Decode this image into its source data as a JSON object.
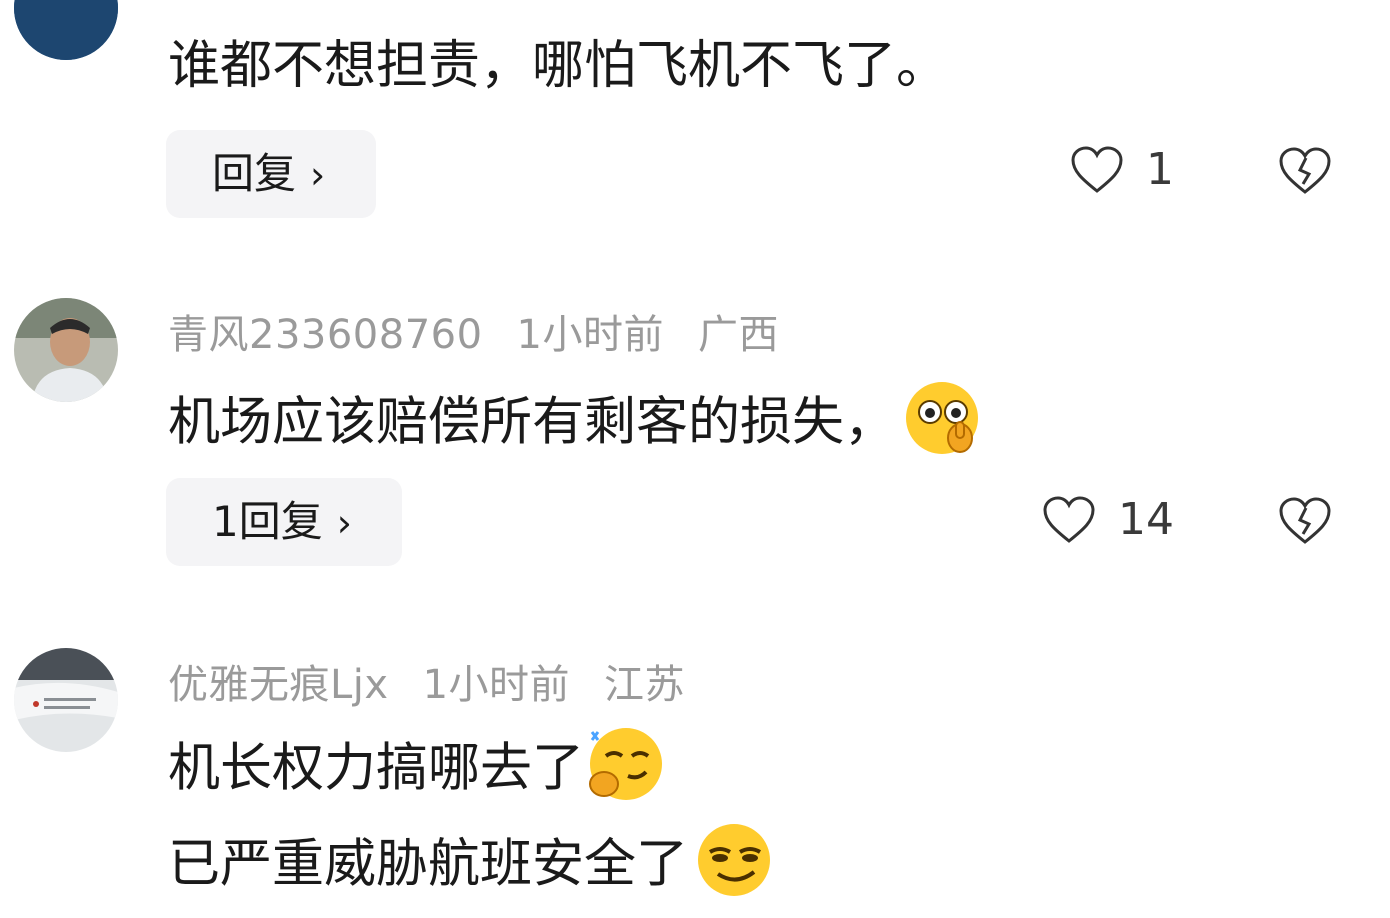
{
  "comments": [
    {
      "author": "",
      "time": "",
      "location": "",
      "text": "谁都不想担责，哪怕飞机不飞了。",
      "reply_label": "回复",
      "reply_chevron": "›",
      "likes": "1",
      "avatar_color": "#2c5f8f",
      "icons": [
        "heart-outline-icon",
        "broken-heart-icon"
      ]
    },
    {
      "author": "青风233608760",
      "time": "1小时前",
      "location": "广西",
      "text": "机场应该赔偿所有剩客的损失，",
      "emoji": "thinking-face-emoji",
      "reply_label": "1回复",
      "reply_chevron": "›",
      "likes": "14",
      "avatar_color": "#8a8f84",
      "icons": [
        "heart-outline-icon",
        "broken-heart-icon"
      ]
    },
    {
      "author": "优雅无痕Ljx",
      "time": "1小时前",
      "location": "江苏",
      "text_lines": [
        "机长权力搞哪去了",
        "已严重威胁航班安全了"
      ],
      "emojis": [
        "smug-thinking-emoji",
        "smirk-face-emoji"
      ],
      "avatar_color": "#cfd4d8"
    }
  ],
  "colors": {
    "meta_text": "#9a9a9a",
    "body_text": "#1a1a1a",
    "reply_bg": "#f4f4f6",
    "emoji_yellow": "#ffcc2e"
  }
}
